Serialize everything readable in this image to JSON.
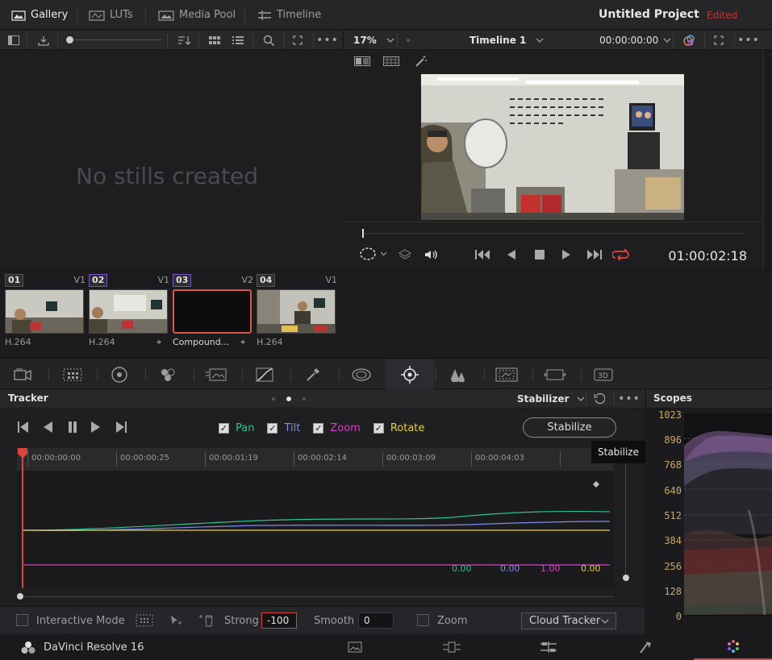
{
  "top": {
    "tabs": [
      {
        "label": "Gallery",
        "active": true
      },
      {
        "label": "LUTs",
        "active": false
      },
      {
        "label": "Media Pool",
        "active": false
      },
      {
        "label": "Timeline",
        "active": false
      }
    ],
    "project_title": "Untitled Project",
    "project_status": "Edited"
  },
  "gallery": {
    "empty_text": "No stills created"
  },
  "viewer": {
    "zoom": "17%",
    "timeline_name": "Timeline 1",
    "timecode_top": "00:00:00:00",
    "timecode": "01:00:02:18"
  },
  "clips": [
    {
      "num": "01",
      "track": "V1",
      "codec": "H.264"
    },
    {
      "num": "02",
      "track": "V1",
      "codec": "H.264"
    },
    {
      "num": "03",
      "track": "V2",
      "codec": "Compound..."
    },
    {
      "num": "04",
      "track": "V1",
      "codec": "H.264"
    }
  ],
  "tracker": {
    "title": "Tracker",
    "mode": "Stabilizer",
    "checks": [
      {
        "label": "Pan",
        "color": "#2ec28e",
        "checked": true
      },
      {
        "label": "Tilt",
        "color": "#7e8cf0",
        "checked": true
      },
      {
        "label": "Zoom",
        "color": "#d63fc6",
        "checked": true
      },
      {
        "label": "Rotate",
        "color": "#e3cf46",
        "checked": true
      }
    ],
    "stabilize_label": "Stabilize",
    "tooltip": "Stabilize",
    "ruler": [
      "00:00:00:00",
      "00:00:00:25",
      "00:00:01:19",
      "00:00:02:14",
      "00:00:03:09",
      "00:00:04:03"
    ],
    "values": [
      {
        "text": "0.00",
        "color": "#2ec28e"
      },
      {
        "text": "0.00",
        "color": "#7e8cf0"
      },
      {
        "text": "1.00",
        "color": "#d63fc6"
      },
      {
        "text": "0.00",
        "color": "#e3cf46"
      }
    ]
  },
  "footer": {
    "interactive_mode": "Interactive Mode",
    "strong_label": "Strong",
    "strong_value": "-100",
    "smooth_label": "Smooth",
    "smooth_value": "0",
    "zoom_label": "Zoom",
    "cloud_tracker": "Cloud Tracker"
  },
  "scopes": {
    "title": "Scopes",
    "scale": [
      "1023",
      "896",
      "768",
      "640",
      "512",
      "384",
      "256",
      "128",
      "0"
    ]
  },
  "bottom": {
    "brand": "DaVinci Resolve 16"
  }
}
